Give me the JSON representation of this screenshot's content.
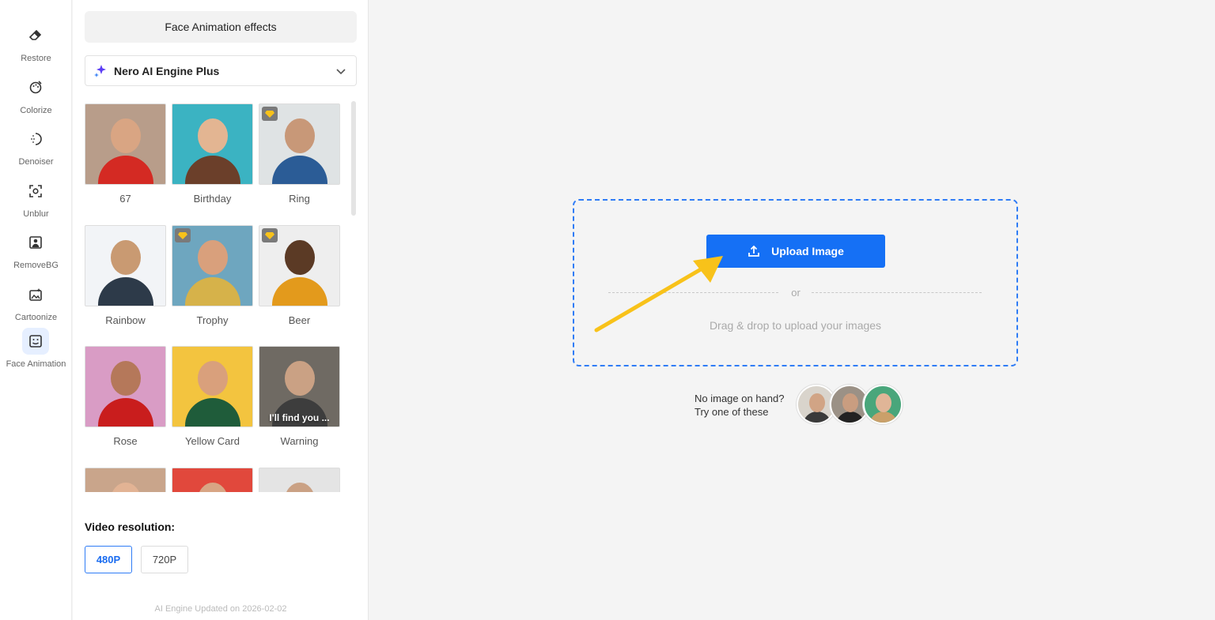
{
  "rail": [
    {
      "label": "Restore",
      "icon": "eraser-icon"
    },
    {
      "label": "Colorize",
      "icon": "palette-icon"
    },
    {
      "label": "Denoiser",
      "icon": "denoise-icon"
    },
    {
      "label": "Unblur",
      "icon": "focus-icon"
    },
    {
      "label": "RemoveBG",
      "icon": "portrait-icon"
    },
    {
      "label": "Cartoonize",
      "icon": "sparkle-image-icon"
    },
    {
      "label": "Face Animation",
      "icon": "smile-face-icon",
      "active": true
    }
  ],
  "panel": {
    "title": "Face Animation effects",
    "engine": "Nero AI Engine Plus",
    "effects": [
      {
        "label": "67",
        "premium": false,
        "bg": "#b89d8a",
        "skin": "#d9a583",
        "shirt": "#d42a23"
      },
      {
        "label": "Birthday",
        "premium": false,
        "bg": "#3bb3c2",
        "skin": "#e3b592",
        "shirt": "#6b3f2a"
      },
      {
        "label": "Ring",
        "premium": true,
        "bg": "#dfe3e4",
        "skin": "#c89878",
        "shirt": "#2b5c96"
      },
      {
        "label": "Rainbow",
        "premium": false,
        "bg": "#f2f4f7",
        "skin": "#c99a72",
        "shirt": "#2d3a49"
      },
      {
        "label": "Trophy",
        "premium": true,
        "bg": "#6ea6bf",
        "skin": "#d9a07c",
        "shirt": "#d6b24a"
      },
      {
        "label": "Beer",
        "premium": true,
        "bg": "#eeeeee",
        "skin": "#5b3a25",
        "shirt": "#e39a1c"
      },
      {
        "label": "Rose",
        "premium": false,
        "bg": "#d99cc5",
        "skin": "#b5785a",
        "shirt": "#c91d1d"
      },
      {
        "label": "Yellow Card",
        "premium": false,
        "bg": "#f3c43f",
        "skin": "#d9a07c",
        "shirt": "#1f5c3a"
      },
      {
        "label": "Warning",
        "premium": false,
        "bg": "#6f6a63",
        "skin": "#caa184",
        "shirt": "#3d3d3d",
        "caption": "I'll find you ..."
      },
      {
        "label": "",
        "premium": false,
        "bg": "#c9a58b",
        "skin": "#e2b394",
        "shirt": "#8a6650"
      },
      {
        "label": "",
        "premium": false,
        "bg": "#e1483c",
        "skin": "#d8a584",
        "shirt": "#333333"
      },
      {
        "label": "",
        "premium": false,
        "bg": "#e4e4e4",
        "skin": "#caa184",
        "shirt": "#555555"
      }
    ],
    "resolution_title": "Video resolution:",
    "resolutions": [
      {
        "label": "480P",
        "active": true
      },
      {
        "label": "720P",
        "active": false
      }
    ],
    "engine_updated": "AI Engine Updated on 2026-02-02"
  },
  "upload": {
    "button_label": "Upload Image",
    "or_text": "or",
    "drag_text": "Drag & drop to upload your images",
    "samples_line1": "No image on hand?",
    "samples_line2": "Try one of these",
    "samples": [
      {
        "bg": "#d9d4cc",
        "skin": "#d1a485",
        "shirt": "#3a3a3a"
      },
      {
        "bg": "#9b9186",
        "skin": "#c99d80",
        "shirt": "#222222"
      },
      {
        "bg": "#49a67b",
        "skin": "#e0b597",
        "shirt": "#caa06a"
      }
    ]
  },
  "colors": {
    "accent": "#1570f5",
    "arrow": "#f8c21a"
  }
}
